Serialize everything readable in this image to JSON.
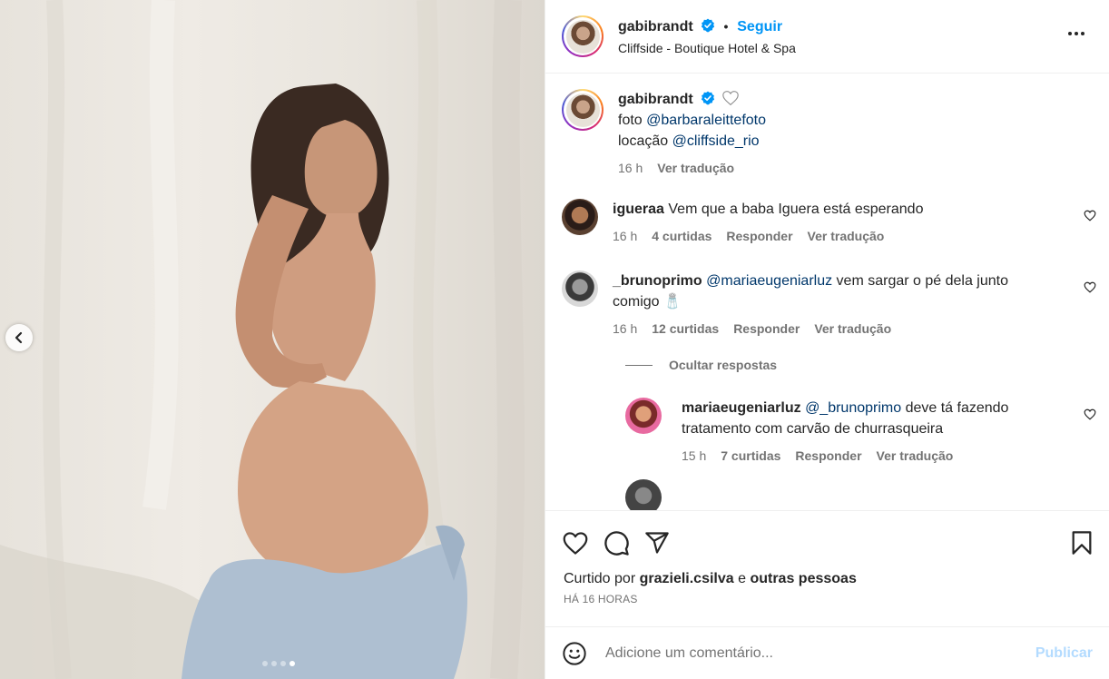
{
  "post": {
    "author": "gabibrandt",
    "follow_label": "Seguir",
    "separator": "•",
    "location": "Cliffside - Boutique Hotel & Spa",
    "carousel": {
      "total": 4,
      "active_index": 3
    }
  },
  "caption": {
    "username": "gabibrandt",
    "line1_prefix": "foto ",
    "line1_mention": "@barbaraleittefoto",
    "line2_prefix": "locação ",
    "line2_mention": "@cliffside_rio",
    "time": "16 h",
    "translate": "Ver tradução"
  },
  "comments": [
    {
      "username": "igueraa",
      "text": "Vem que a baba Iguera está esperando",
      "time": "16 h",
      "likes": "4 curtidas",
      "reply": "Responder",
      "translate": "Ver tradução"
    },
    {
      "username": "_brunoprimo",
      "mention": "@mariaeugeniarluz",
      "text": " vem sargar o pé dela junto comigo 🧂",
      "time": "16 h",
      "likes": "12 curtidas",
      "reply": "Responder",
      "translate": "Ver tradução",
      "hide_replies": "Ocultar respostas",
      "replies": [
        {
          "username": "mariaeugeniarluz",
          "mention": "@_brunoprimo",
          "text": " deve tá fazendo tratamento com carvão de churrasqueira",
          "time": "15 h",
          "likes": "7 curtidas",
          "reply": "Responder",
          "translate": "Ver tradução"
        }
      ]
    }
  ],
  "likes_line": {
    "prefix": "Curtido por ",
    "user": "grazieli.csilva",
    "middle": " e ",
    "others": "outras pessoas"
  },
  "posted_ago": "HÁ 16 HORAS",
  "comment_box": {
    "placeholder": "Adicione um comentário...",
    "publish_label": "Publicar"
  },
  "colors": {
    "accent": "#0095f6",
    "mention": "#00376b",
    "muted": "#737373",
    "publish_disabled": "#b3dbff"
  }
}
